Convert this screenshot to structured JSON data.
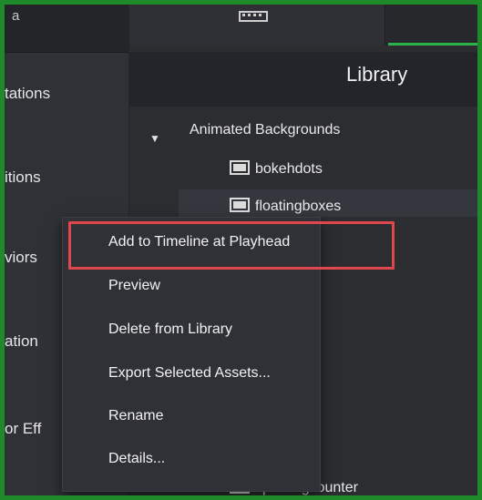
{
  "left_panel": {
    "top_fragment": "a",
    "items": [
      {
        "label": "tations"
      },
      {
        "label": "itions"
      },
      {
        "label": "viors"
      },
      {
        "label": "ation"
      },
      {
        "label": "or Eff"
      }
    ]
  },
  "library": {
    "title": "Library",
    "folder": "Animated Backgrounds",
    "assets": [
      {
        "label": "bokehdots"
      },
      {
        "label": "floatingboxes"
      },
      {
        "label": "spinningcounter"
      }
    ]
  },
  "context_menu": {
    "items": [
      {
        "label": "Add to Timeline at Playhead",
        "highlighted": true
      },
      {
        "label": "Preview"
      },
      {
        "label": "Delete from Library"
      },
      {
        "label": "Export Selected Assets..."
      },
      {
        "label": "Rename"
      },
      {
        "label": "Details..."
      }
    ]
  },
  "colors": {
    "frame_border": "#1f8a2a",
    "highlight_box": "#e0474c",
    "tab_underline": "#2bb24a"
  }
}
